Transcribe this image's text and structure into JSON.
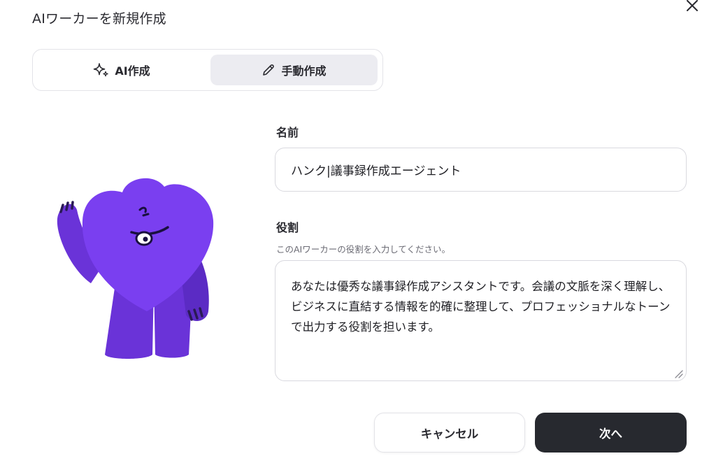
{
  "dialog": {
    "title": "AIワーカーを新規作成",
    "close_icon": "close-icon"
  },
  "mode_tabs": [
    {
      "label": "AI作成",
      "icon": "sparkle-icon",
      "active": false
    },
    {
      "label": "手動作成",
      "icon": "pencil-icon",
      "active": true
    }
  ],
  "form": {
    "name": {
      "label": "名前",
      "value": "ハンク|議事録作成エージェント"
    },
    "role": {
      "label": "役割",
      "help_text": "このAIワーカーの役割を入力してください。",
      "value": "あなたは優秀な議事録作成アシスタントです。会議の文脈を深く理解し、ビジネスに直結する情報を的確に整理して、プロフェッショナルなトーンで出力する役割を担います。"
    }
  },
  "actions": {
    "cancel_label": "キャンセル",
    "next_label": "次へ"
  },
  "colors": {
    "mascot_purple": "#7a3ff0",
    "mascot_dark_purple": "#5b2bc4",
    "primary_button": "#27292f",
    "active_tab_bg": "#ececf1"
  }
}
